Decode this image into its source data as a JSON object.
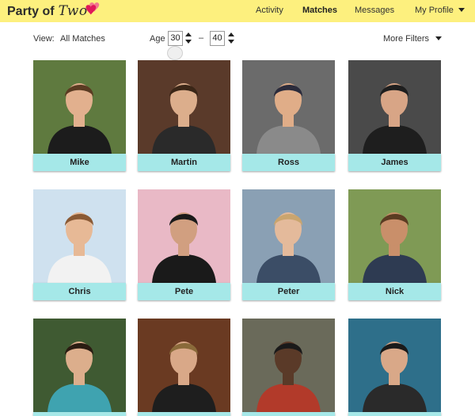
{
  "header": {
    "brand_party": "Party of",
    "brand_two": "Two",
    "nav": [
      {
        "label": "Activity",
        "active": false
      },
      {
        "label": "Matches",
        "active": true
      },
      {
        "label": "Messages",
        "active": false
      },
      {
        "label": "My Profile",
        "active": false
      }
    ],
    "accent": "#fdf07e",
    "heart_colors": [
      "#e0185a",
      "#f3778f"
    ]
  },
  "filters": {
    "view_label": "View:",
    "view_value": "All Matches",
    "age_label": "Age",
    "age_min": "30",
    "age_max": "40",
    "age_separator": "–",
    "more_filters": "More Filters"
  },
  "name_bar_color": "#a5e8e8",
  "matches": [
    {
      "name": "Mike",
      "bg": "#5f7a3f",
      "shirt": "#1c1c1c",
      "skin": "#e2b08e",
      "hair": "#5a3b22"
    },
    {
      "name": "Martin",
      "bg": "#5a3a2a",
      "shirt": "#2a2a2a",
      "skin": "#dcae8c",
      "hair": "#3a2617"
    },
    {
      "name": "Ross",
      "bg": "#6b6b6b",
      "shirt": "#8a8a8a",
      "skin": "#e0ad88",
      "hair": "#2b2b3b"
    },
    {
      "name": "James",
      "bg": "#4a4a4a",
      "shirt": "#1e1e1e",
      "skin": "#d8a586",
      "hair": "#1e1e1e"
    },
    {
      "name": "Chris",
      "bg": "#cfe1ef",
      "shirt": "#f2f2f2",
      "skin": "#e7b996",
      "hair": "#8a5a35"
    },
    {
      "name": "Pete",
      "bg": "#e9b9c6",
      "shirt": "#1a1a1a",
      "skin": "#d19f80",
      "hair": "#1a1a1a"
    },
    {
      "name": "Peter",
      "bg": "#8aa0b4",
      "shirt": "#3b4d66",
      "skin": "#e4ba9b",
      "hair": "#caa56e"
    },
    {
      "name": "Nick",
      "bg": "#7f9a55",
      "shirt": "#2e3b52",
      "skin": "#c98f6a",
      "hair": "#5a3b22"
    },
    {
      "name": "",
      "bg": "#3f5a32",
      "shirt": "#3fa3b0",
      "skin": "#dcae8c",
      "hair": "#2a1c12"
    },
    {
      "name": "",
      "bg": "#6a3a22",
      "shirt": "#1e1e1e",
      "skin": "#d9a888",
      "hair": "#8a6a3a"
    },
    {
      "name": "",
      "bg": "#6a6a5a",
      "shirt": "#b23a2a",
      "skin": "#5a3a28",
      "hair": "#1a1a1a"
    },
    {
      "name": "",
      "bg": "#2e6f8a",
      "shirt": "#2a2a2a",
      "skin": "#d9a888",
      "hair": "#1a1a1a"
    }
  ]
}
